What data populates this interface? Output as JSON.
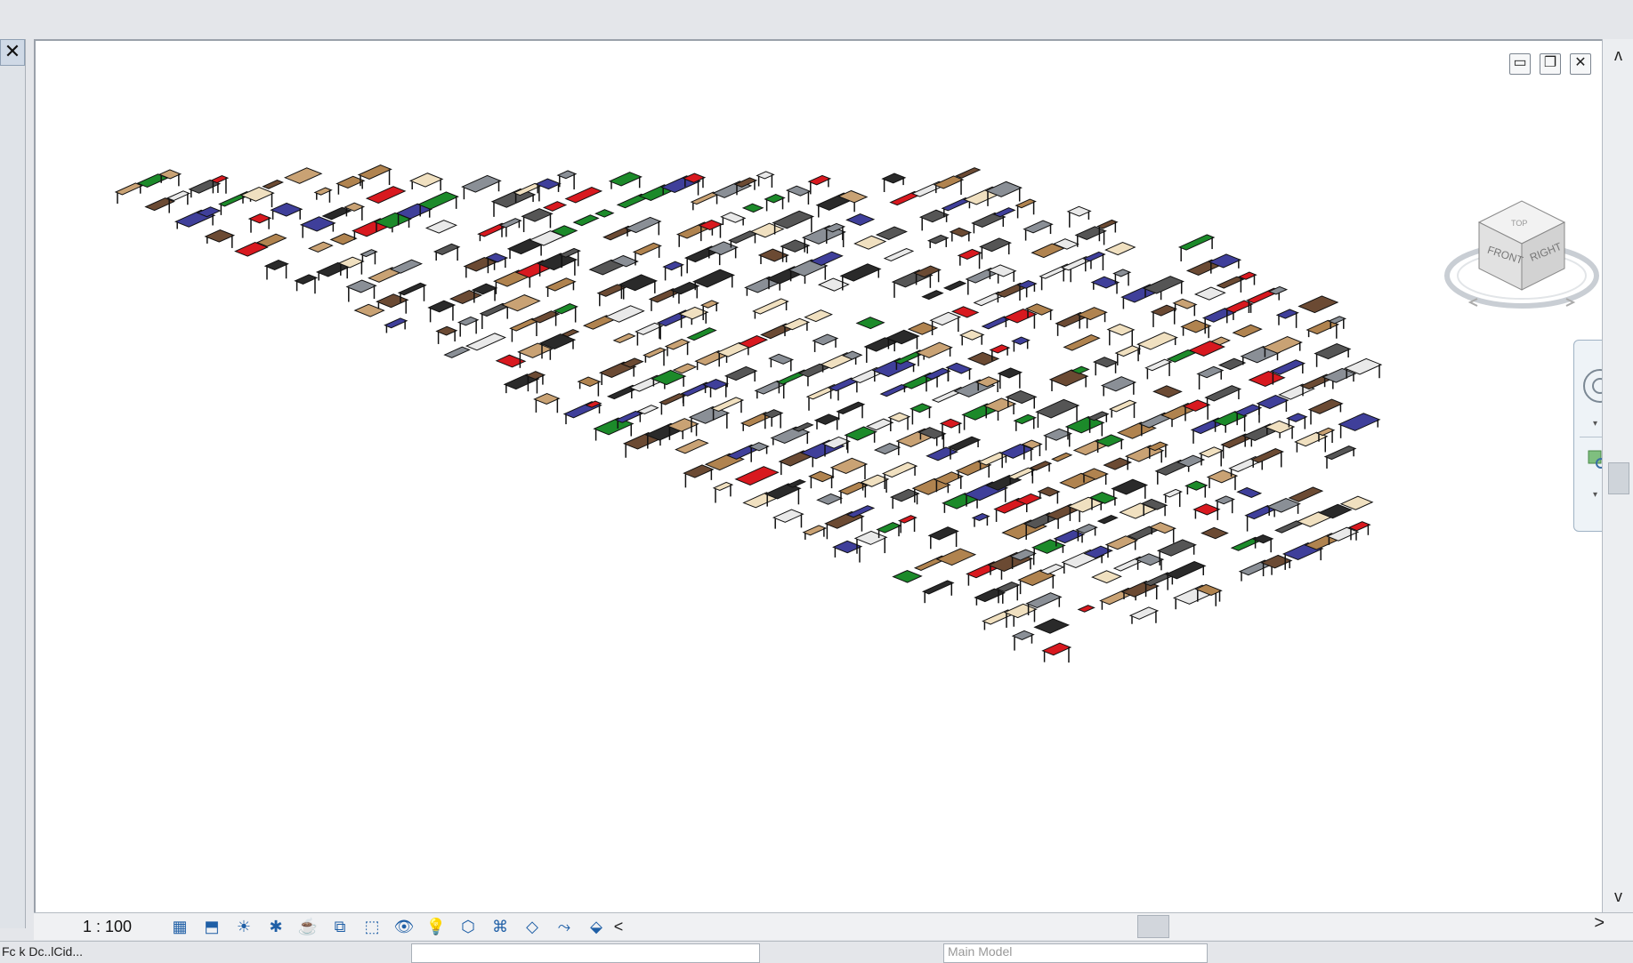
{
  "left_panel": {
    "close_glyph": "✕"
  },
  "viewport": {
    "window_controls": {
      "minimize": "▭",
      "restore": "❐",
      "close": "✕"
    },
    "viewcube": {
      "front_label": "FRONT",
      "right_label": "RIGHT",
      "top_label": "TOP"
    },
    "navigation_bar": {
      "close": "⊗",
      "dropdown": "▾",
      "options": "⊖"
    }
  },
  "vertical_scrollbar": {
    "up": "ʌ",
    "down": "v"
  },
  "view_control_bar": {
    "scale": "1 : 100",
    "icons": [
      "detail-level-icon",
      "visual-style-icon",
      "sun-path-icon",
      "shadows-icon",
      "render-icon",
      "crop-view-icon",
      "show-crop-region-icon",
      "temporary-hide-icon",
      "reveal-hidden-icon",
      "temporary-view-properties-icon",
      "worksharing-display-icon",
      "analytical-model-icon",
      "highlight-displacement-icon",
      "constraints-icon"
    ],
    "collapse": "<",
    "scroll_right": ">"
  },
  "status_bar": {
    "text": "Fc k Dc..lCid...",
    "model_field": "Main Model"
  },
  "colors": {
    "accent_blue": "#1f5fa6",
    "felt_green": "#1c8a2a",
    "wood": "#8a5a3c",
    "table_red": "#d8191f"
  }
}
